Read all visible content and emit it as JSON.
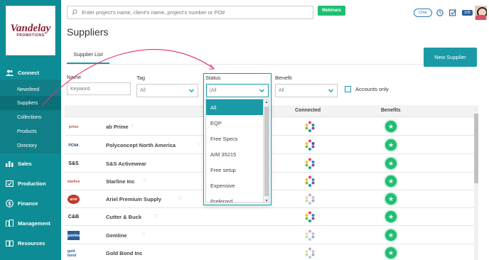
{
  "brand": {
    "logo_main": "Vandelay",
    "logo_sub": "PROMOTIONS"
  },
  "sidebar": {
    "sections": [
      {
        "label": "Connect",
        "icon": "users-icon"
      },
      {
        "label": "Sales",
        "icon": "bar-chart-icon"
      },
      {
        "label": "Production",
        "icon": "production-icon"
      },
      {
        "label": "Finance",
        "icon": "dollar-icon"
      },
      {
        "label": "Management",
        "icon": "building-icon"
      },
      {
        "label": "Resources",
        "icon": "book-icon"
      }
    ],
    "connect_items": [
      "Newsfeed",
      "Suppliers",
      "Collections",
      "Products",
      "Directory"
    ]
  },
  "topbar": {
    "search_placeholder": "Enter project's name, client's name, project's number or PO#",
    "webinars_label": "Webinars",
    "chat_label": "Chat",
    "notification_count": "105"
  },
  "page": {
    "title": "Suppliers",
    "tab_label": "Supplier List",
    "new_button": "New Supplier"
  },
  "filters": {
    "name_label": "Name",
    "keyword_placeholder": "Keyword",
    "tag_label": "Tag",
    "tag_value": "All",
    "status_label": "Status",
    "status_value": "|All",
    "benefit_label": "Benefit",
    "benefit_value": "All",
    "accounts_only_label": "Accounts only"
  },
  "status_options": [
    "All",
    "EQP",
    "Free Specs",
    "AIM 35215",
    "Free setup",
    "Expensive",
    "Preferred"
  ],
  "table": {
    "headers": {
      "connected": "Connected",
      "benefits": "Benefits"
    },
    "rows": [
      {
        "name": "ab Prime",
        "logo": "prime"
      },
      {
        "name": "Polyconcept North America",
        "logo": "PCNA"
      },
      {
        "name": "S&S Activewear",
        "logo": "S&S"
      },
      {
        "name": "Starline Inc",
        "logo": "starline"
      },
      {
        "name": "Ariel Premium Supply",
        "logo": "ariel"
      },
      {
        "name": "Cutter & Buck",
        "logo": "C&B"
      },
      {
        "name": "Gemline",
        "logo": "gemline"
      },
      {
        "name": "Gold Bond Inc",
        "logo": "gold bond"
      }
    ]
  },
  "colors": {
    "sidebar": "#0e8c95",
    "accent": "#1a9aa7",
    "success": "#1fbf72",
    "brand": "#8a1f3a"
  }
}
